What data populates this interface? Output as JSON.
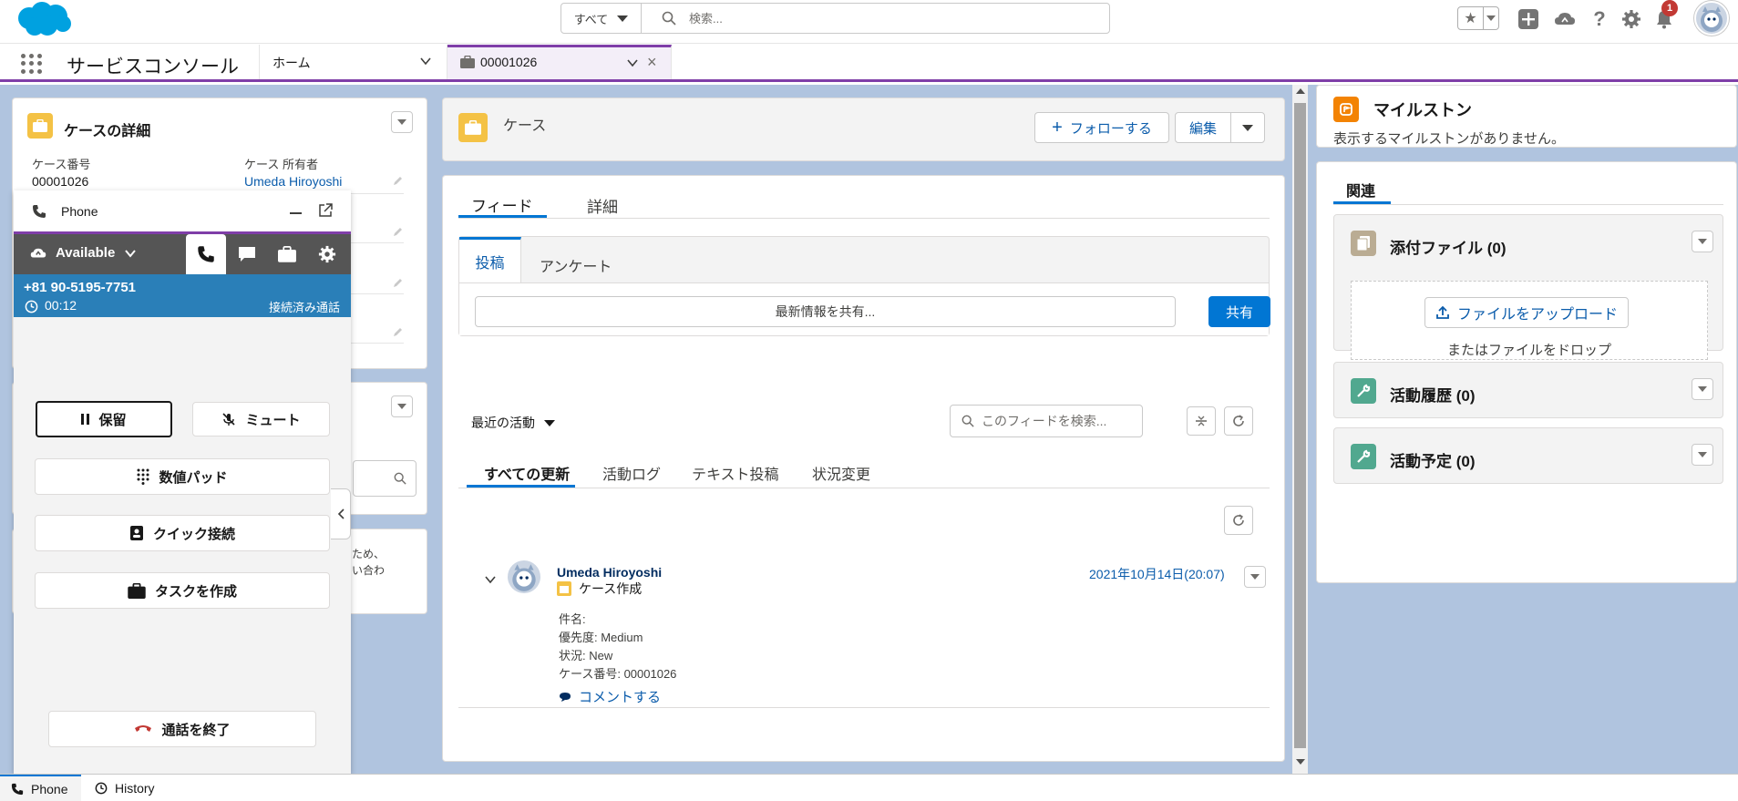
{
  "header": {
    "search_scope": "すべて",
    "search_placeholder": "検索...",
    "notification_count": "1"
  },
  "nav": {
    "app_name": "サービスコンソール",
    "home_tab": "ホーム",
    "case_tab": "00001026"
  },
  "case_detail": {
    "title": "ケースの詳細",
    "case_number_label": "ケース番号",
    "case_number": "00001026",
    "owner_label": "ケース 所有者",
    "owner": "Umeda Hiroyoshi"
  },
  "left_card3": {
    "line1": "ため、",
    "line2": "い合わ"
  },
  "phone": {
    "title": "Phone",
    "presence": "Available",
    "call_number": "+81 90-5195-7751",
    "call_time": "00:12",
    "call_status": "接続済み通話",
    "hold": "保留",
    "mute": "ミュート",
    "dialpad": "数値パッド",
    "quick_connect": "クイック接続",
    "create_task": "タスクを作成",
    "end_call": "通話を終了"
  },
  "case_highlight": {
    "label": "ケース",
    "follow": "フォローする",
    "edit": "編集"
  },
  "feed": {
    "tab_feed": "フィード",
    "tab_detail": "詳細",
    "pub_post": "投稿",
    "pub_survey": "アンケート",
    "share_placeholder": "最新情報を共有...",
    "share_button": "共有",
    "sort_label": "最近の活動",
    "search_placeholder": "このフィードを検索...",
    "filters": [
      "すべての更新",
      "活動ログ",
      "テキスト投稿",
      "状況変更"
    ],
    "post": {
      "author": "Umeda Hiroyoshi",
      "action": "ケース作成",
      "date": "2021年10月14日(20:07)",
      "lines": [
        "件名:",
        "優先度: Medium",
        "状況: New",
        "ケース番号: 00001026"
      ],
      "comment": "コメントする"
    }
  },
  "milestone": {
    "title": "マイルストン",
    "message": "表示するマイルストンがありません。"
  },
  "related": {
    "tab": "関連",
    "attachments": "添付ファイル (0)",
    "upload": "ファイルをアップロード",
    "drop": "またはファイルをドロップ",
    "activity_history": "活動履歴 (0)",
    "open_activities": "活動予定 (0)"
  },
  "utility": {
    "phone": "Phone",
    "history": "History"
  },
  "colors": {
    "brand": "#0176d3",
    "console_accent": "#7f3ea8",
    "call_bar": "#2a7fb8",
    "workspace_bg": "#b0c4df"
  }
}
